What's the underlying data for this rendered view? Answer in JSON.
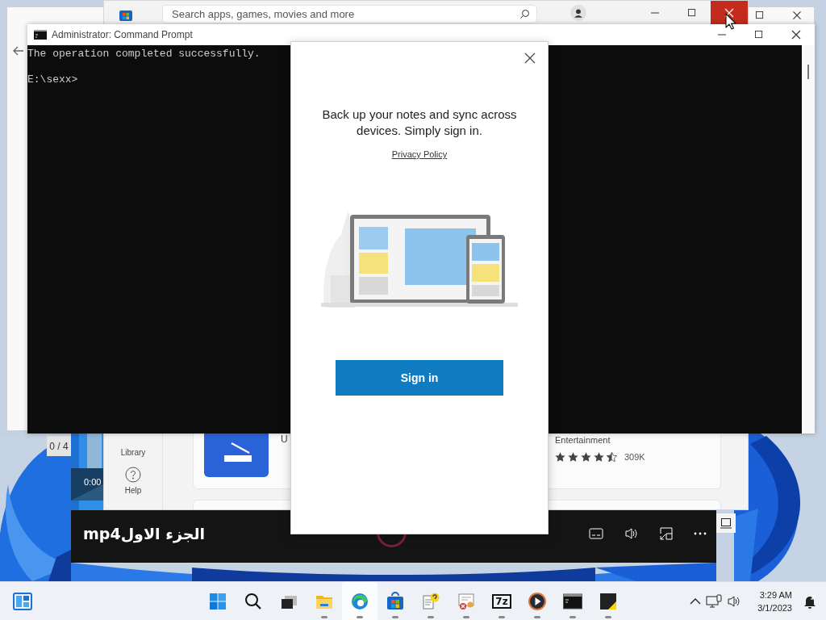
{
  "page_counter": "0 / 4",
  "video_player": {
    "time": "0:00",
    "title": "الجزء الاولmp4"
  },
  "store": {
    "search": {
      "placeholder": "Search apps, games, movies and more"
    },
    "sidebar": {
      "items": [
        {
          "label": "Library",
          "kind": "library"
        },
        {
          "label": "Help",
          "kind": "help"
        }
      ]
    },
    "apps": [
      {
        "name": "U"
      },
      {
        "category": "Entertainment",
        "stars": 4.5,
        "reviews": "309K"
      }
    ]
  },
  "command_prompt": {
    "title": "Administrator: Command Prompt",
    "output": "The operation completed successfully.\n\nE:\\sexx>"
  },
  "dialog": {
    "heading": "Back up your notes and sync across devices. Simply sign in.",
    "link": "Privacy Policy",
    "button": "Sign in"
  },
  "taskbar": {
    "items": [
      {
        "kind": "start",
        "running": false,
        "selected": false
      },
      {
        "kind": "search",
        "running": false,
        "selected": false
      },
      {
        "kind": "taskview",
        "running": false,
        "selected": false
      },
      {
        "kind": "explorer",
        "running": true,
        "selected": false
      },
      {
        "kind": "edge",
        "running": true,
        "selected": true
      },
      {
        "kind": "store",
        "running": true,
        "selected": false
      },
      {
        "kind": "helpdoc",
        "running": true,
        "selected": false
      },
      {
        "kind": "certificate",
        "running": true,
        "selected": false
      },
      {
        "kind": "sevenzip",
        "label": "7z",
        "running": true,
        "selected": false
      },
      {
        "kind": "player",
        "running": true,
        "selected": false
      },
      {
        "kind": "terminal",
        "running": true,
        "selected": false
      },
      {
        "kind": "notes",
        "running": true,
        "selected": false
      }
    ],
    "clock": {
      "time": "3:29 AM",
      "date": "3/1/2023"
    }
  }
}
